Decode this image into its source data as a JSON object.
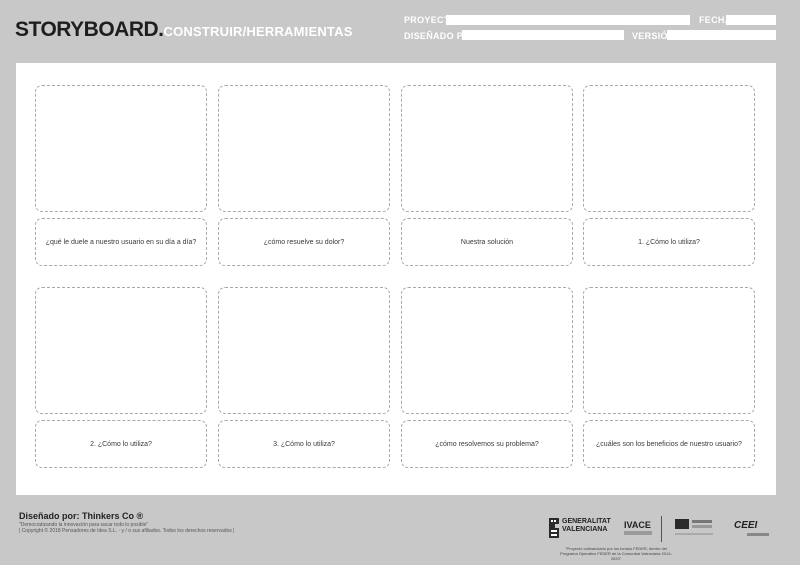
{
  "header": {
    "title": "STORYBOARD.",
    "subtitle": "CONSTRUIR/HERRAMIENTAS",
    "fields": {
      "proyecto": "PROYECTO",
      "fecha": "FECHA",
      "disenado_por": "DISEÑADO POR",
      "version": "VERSIÓN"
    }
  },
  "panels": [
    {
      "caption": "¿qué le duele a nuestro usuario en su día a día?"
    },
    {
      "caption": "¿cómo resuelve su dolor?"
    },
    {
      "caption": "Nuestra solución"
    },
    {
      "caption": "1. ¿Cómo lo utiliza?"
    },
    {
      "caption": "2. ¿Cómo lo utiliza?"
    },
    {
      "caption": "3. ¿Cómo lo utiliza?"
    },
    {
      "caption": "¿cómo resolvemos su problema?"
    },
    {
      "caption": "¿cuáles son los beneficios de nuestro usuario?"
    }
  ],
  "footer": {
    "designed_by": "Diseñado por: Thinkers Co ®",
    "tagline": "\"Democratizando la innovación para sacar todo lo posible\"",
    "copyright": "| Copyright © 2018 Pensadores de Idea S.L. · y / o sus afiliados. Todos los derechos reservados |",
    "logos": {
      "generalitat": "GENERALITAT VALENCIANA",
      "ivace": "IVACE",
      "ceei": "CEEI"
    },
    "note": "\"Proyecto cofinanciado por los fondos FEDER, dentro del Programa Operativo FEDER de la Comunitat Valenciana 2014-2020\""
  }
}
